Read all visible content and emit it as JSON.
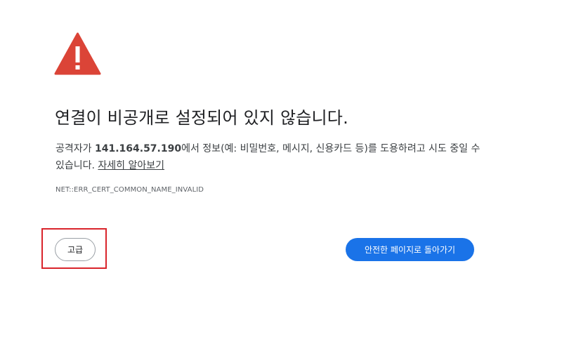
{
  "icon": {
    "name": "warning-triangle-icon",
    "color": "#db4437"
  },
  "heading": "연결이 비공개로 설정되어 있지 않습니다.",
  "description": {
    "prefix": "공격자가 ",
    "host": "141.164.57.190",
    "suffix": "에서 정보(예: 비밀번호, 메시지, 신용카드 등)를 도용하려고 시도 중일 수 있습니다. ",
    "learn_more": "자세히 알아보기"
  },
  "error_code": "NET::ERR_CERT_COMMON_NAME_INVALID",
  "buttons": {
    "advanced": "고급",
    "back_to_safety": "안전한 페이지로 돌아가기"
  },
  "colors": {
    "primary_button": "#1a73e8",
    "highlight_border": "#d9242b"
  }
}
